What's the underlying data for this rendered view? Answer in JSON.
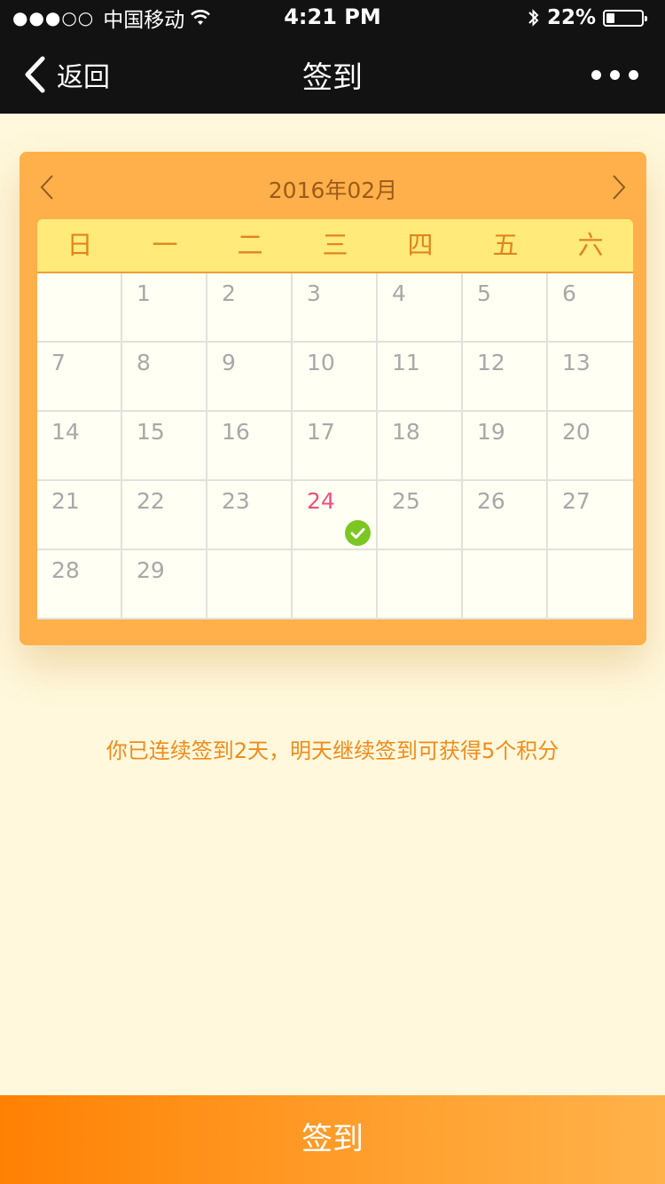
{
  "status_bar": {
    "signal": "●●●○○",
    "carrier": "中国移动",
    "time": "4:21 PM",
    "battery_percent": "22%",
    "battery_level": 0.22,
    "icons": [
      "wifi-icon",
      "bluetooth-icon",
      "battery-icon"
    ]
  },
  "nav": {
    "back_label": "返回",
    "title": "签到",
    "icons": [
      "chevron-left-icon",
      "more-icon"
    ]
  },
  "calendar": {
    "month_label": "2016年02月",
    "weekdays": [
      "日",
      "一",
      "二",
      "三",
      "四",
      "五",
      "六"
    ],
    "cells": [
      "",
      "1",
      "2",
      "3",
      "4",
      "5",
      "6",
      "7",
      "8",
      "9",
      "10",
      "11",
      "12",
      "13",
      "14",
      "15",
      "16",
      "17",
      "18",
      "19",
      "20",
      "21",
      "22",
      "23",
      "24",
      "25",
      "26",
      "27",
      "28",
      "29",
      "",
      "",
      "",
      "",
      ""
    ],
    "today": "24",
    "checked_in": [
      "24"
    ],
    "icons": [
      "chevron-left-icon",
      "chevron-right-icon",
      "check-icon"
    ]
  },
  "streak_message": "你已连续签到2天，明天继续签到可获得5个积分",
  "signin_button_label": "签到",
  "colors": {
    "page_background": "#fff8dc",
    "bar_background": "#121212",
    "calendar_card": "#ffb04a",
    "weekday_bar": "#ffea7a",
    "today": "#f0507a",
    "check": "#7cc623",
    "accent_text": "#f08b1c",
    "button_gradient_start": "#ff8103",
    "button_gradient_end": "#ffb24a"
  }
}
